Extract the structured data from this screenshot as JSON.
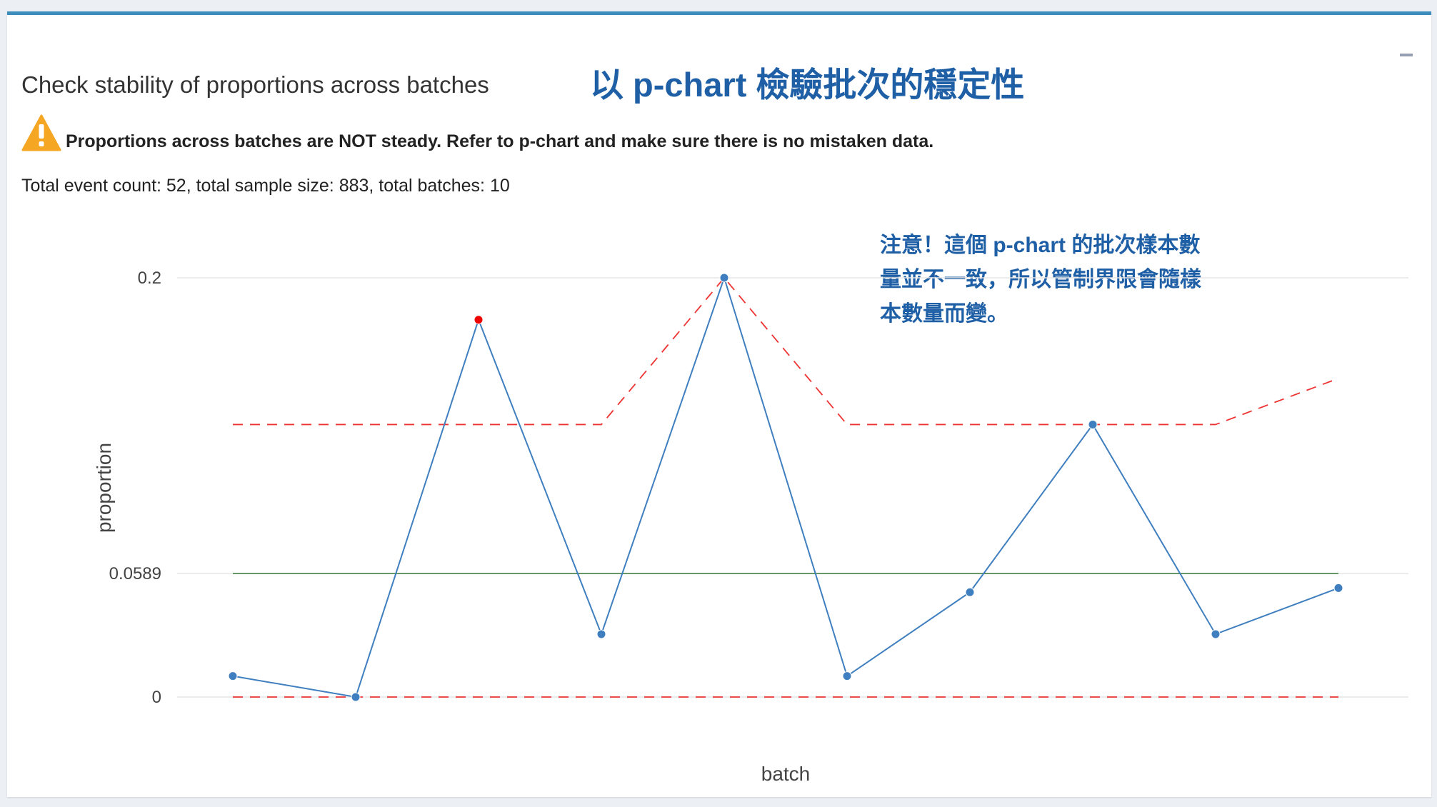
{
  "box": {
    "title": "Check stability of proportions across batches",
    "warning": "Proportions across batches are NOT steady. Refer to p-chart and make sure there is no mistaken data.",
    "summary": "Total event count: 52, total sample size: 883, total batches: 10"
  },
  "annotations": {
    "title": "以 p-chart 檢驗批次的穩定性",
    "note_lines": [
      "注意！這個 p-chart 的批次樣本數",
      "量並不一致，所以管制界限會隨樣",
      "本數量而變。"
    ]
  },
  "icons": {
    "warning": "warning-triangle-icon",
    "collapse": "minus-icon"
  },
  "colors": {
    "accent": "#3c8dbc",
    "line": "#3f7fbf",
    "out_of_control_point": "#ee0000",
    "control_limits": "#ee3333",
    "center_line": "#3b7a3b",
    "warning_icon": "#f5a623",
    "annotation": "#1f5fa6"
  },
  "chart_data": {
    "type": "line",
    "xlabel": "batch",
    "ylabel": "proportion",
    "ylim": [
      0,
      0.2
    ],
    "y_ticks": [
      0,
      0.0589,
      0.2
    ],
    "y_tick_labels": [
      "0",
      "0.0589",
      "0.2"
    ],
    "x_ticks_shown": false,
    "batches": [
      1,
      2,
      3,
      4,
      5,
      6,
      7,
      8,
      9,
      10
    ],
    "series": [
      {
        "values": [
          0.01,
          0.0,
          0.18,
          0.03,
          0.2,
          0.01,
          0.05,
          0.13,
          0.03,
          0.052
        ],
        "out_of_control": [
          false,
          false,
          true,
          false,
          false,
          false,
          false,
          false,
          false,
          false
        ]
      }
    ],
    "center_line": 0.0589,
    "upper_control_limit": [
      0.13,
      0.13,
      0.13,
      0.13,
      0.2,
      0.13,
      0.13,
      0.13,
      0.13,
      0.152
    ],
    "lower_control_limit": [
      0,
      0,
      0,
      0,
      0,
      0,
      0,
      0,
      0,
      0
    ],
    "grid": true
  }
}
